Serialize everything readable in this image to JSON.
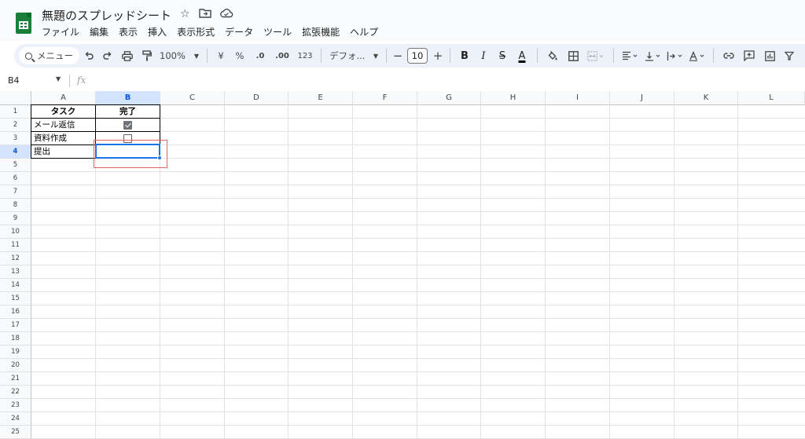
{
  "titlebar": {
    "doc_title": "無題のスプレッドシート",
    "icons": [
      "star-icon",
      "move-folder-icon",
      "cloud-status-icon"
    ],
    "menus": [
      "ファイル",
      "編集",
      "表示",
      "挿入",
      "表示形式",
      "データ",
      "ツール",
      "拡張機能",
      "ヘルプ"
    ]
  },
  "toolbar": {
    "search_label": "メニュー",
    "zoom": "100%",
    "currency": "¥",
    "percent": "%",
    "decrease_decimal": ".0",
    "increase_decimal": ".00",
    "number_format": "123",
    "font": "デフォ...",
    "font_size": "10",
    "bold": "B",
    "italic": "I",
    "strikethrough": "S",
    "text_color": "A",
    "text_color_value": "#000000"
  },
  "formula_bar": {
    "name_box": "B4",
    "fx": "fx"
  },
  "grid": {
    "columns": [
      "A",
      "B",
      "C",
      "D",
      "E",
      "F",
      "G",
      "H",
      "I",
      "J",
      "K",
      "L"
    ],
    "selected_column": "B",
    "rows": [
      "1",
      "2",
      "3",
      "4",
      "5",
      "6",
      "7",
      "8",
      "9",
      "10",
      "11",
      "12",
      "13",
      "14",
      "15",
      "16",
      "17",
      "18",
      "19",
      "20",
      "21",
      "22",
      "23",
      "24",
      "25"
    ],
    "selected_row": "4",
    "headers": {
      "task": "タスク",
      "done": "完了"
    },
    "tasks": [
      {
        "name": "メール返信",
        "checked": true
      },
      {
        "name": "資料作成",
        "checked": false
      },
      {
        "name": "提出",
        "checked": null
      }
    ]
  },
  "colors": {
    "brand": "#188038",
    "selection": "#1a73e8",
    "highlight": "#e06666"
  }
}
